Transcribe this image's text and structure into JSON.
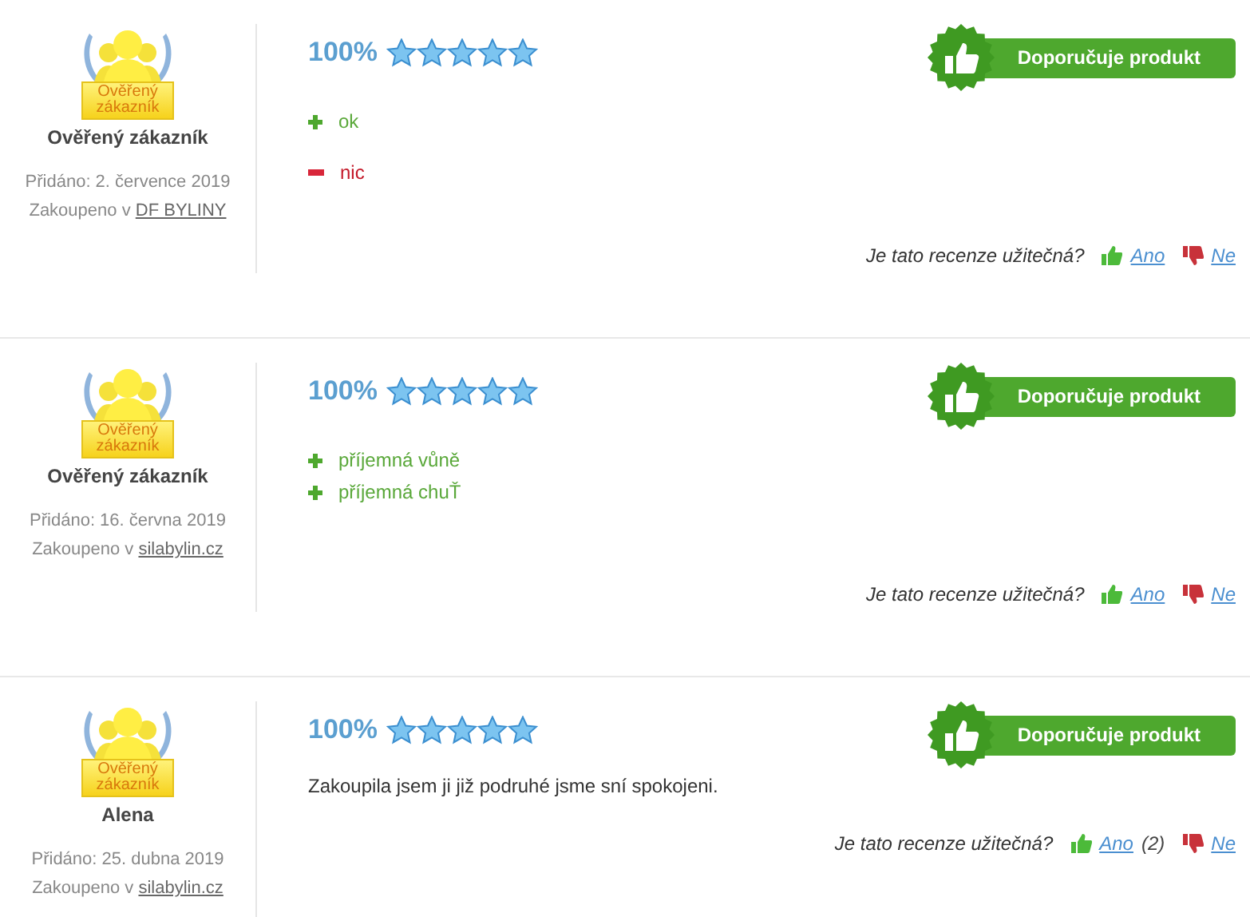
{
  "reviews": [
    {
      "badge_label": "Ověřený zákazník",
      "author": "Ověřený zákazník",
      "added": "Přidáno: 2. července 2019",
      "store_prefix": "Zakoupeno v",
      "store": "DF BYLINY",
      "rating": "100%",
      "stars": 5,
      "recommends": true,
      "recommend_label": "Doporučuje produkt",
      "items": [
        {
          "kind": "pro",
          "text": "ok"
        },
        {
          "kind": "con",
          "text": "nic"
        }
      ],
      "helpful_question": "Je tato recenze užitečná?",
      "yes_label": "Ano",
      "no_label": "Ne"
    },
    {
      "badge_label": "Ověřený zákazník",
      "author": "Ověřený zákazník",
      "added": "Přidáno: 16. června 2019",
      "store_prefix": "Zakoupeno v",
      "store": "silabylin.cz",
      "rating": "100%",
      "stars": 5,
      "recommends": true,
      "recommend_label": "Doporučuje produkt",
      "items": [
        {
          "kind": "pro",
          "text": "příjemná vůně"
        },
        {
          "kind": "pro",
          "text": "příjemná chuŤ"
        }
      ],
      "helpful_question": "Je tato recenze užitečná?",
      "yes_label": "Ano",
      "no_label": "Ne"
    },
    {
      "badge_label": "Ověřený zákazník",
      "author": "Alena",
      "added": "Přidáno: 25. dubna 2019",
      "store_prefix": "Zakoupeno v",
      "store": "silabylin.cz",
      "rating": "100%",
      "stars": 5,
      "recommends": true,
      "recommend_label": "Doporučuje produkt",
      "items": [
        {
          "kind": "text",
          "text": "Zakoupila jsem ji již podruhé jsme sní spokojeni."
        }
      ],
      "helpful_question": "Je tato recenze užitečná?",
      "yes_label": "Ano",
      "yes_count": "(2)",
      "no_label": "Ne"
    }
  ]
}
